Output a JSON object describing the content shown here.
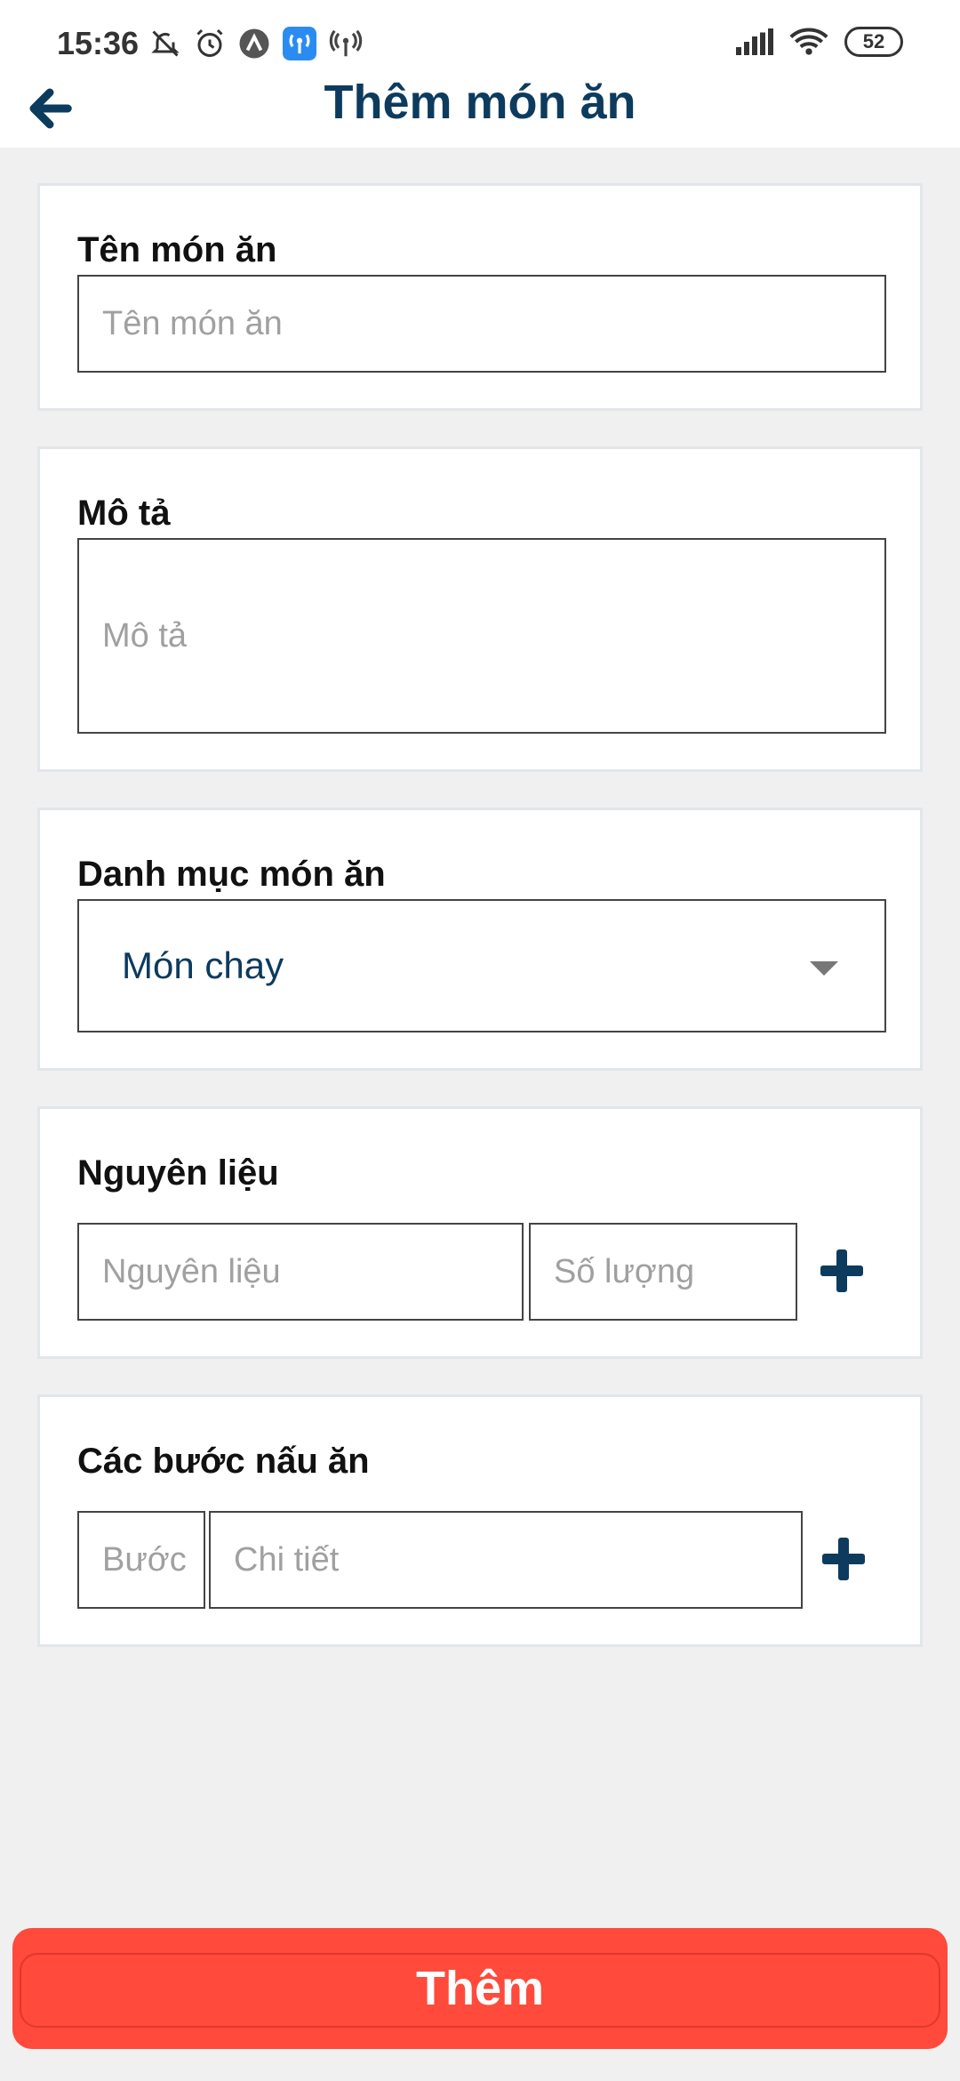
{
  "status_bar": {
    "time": "15:36",
    "battery": "52",
    "icons": [
      "bell-off-icon",
      "alarm-icon",
      "app-icon",
      "hotspot-icon",
      "hotspot-icon",
      "signal-icon",
      "wifi-icon",
      "battery-icon"
    ]
  },
  "header": {
    "title": "Thêm món ăn",
    "back_icon": "arrow-left-icon"
  },
  "form": {
    "name": {
      "label": "Tên món ăn",
      "placeholder": "Tên món ăn",
      "value": ""
    },
    "description": {
      "label": "Mô tả",
      "placeholder": "Mô tả",
      "value": ""
    },
    "category": {
      "label": "Danh mục món ăn",
      "selected": "Món chay"
    },
    "ingredients": {
      "label": "Nguyên liệu",
      "ingredient_placeholder": "Nguyên liệu",
      "quantity_placeholder": "Số lượng",
      "add_icon": "plus-icon"
    },
    "steps": {
      "label": "Các bước nấu ăn",
      "step_placeholder": "Bước",
      "detail_placeholder": "Chi tiết",
      "add_icon": "plus-icon"
    }
  },
  "submit_label": "Thêm",
  "colors": {
    "primary": "#0d3b5e",
    "accent": "#ff4a3c",
    "background": "#f0f0f0",
    "card_border": "#e2e6ea"
  }
}
